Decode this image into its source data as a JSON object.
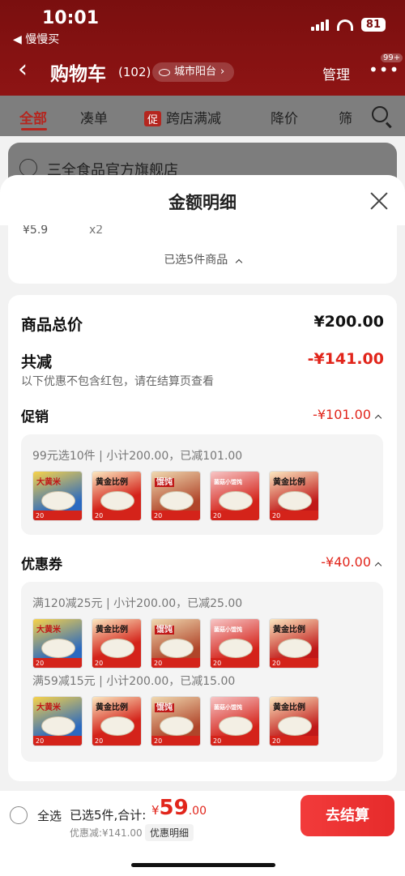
{
  "status_bar": {
    "time": "10:01",
    "back_app": "◀ 慢慢买",
    "battery": "81"
  },
  "header": {
    "back_icon": "chevron-left-icon",
    "title": "购物车",
    "count": "(102)",
    "address": "城市阳台",
    "manage": "管理",
    "more": "•••",
    "badge": "99+"
  },
  "filters": [
    "全部",
    "凑单",
    "跨店满减",
    "降价",
    "筛"
  ],
  "promo_tag": "促",
  "shop_name": "三全食品官方旗舰店",
  "sheet": {
    "title": "金额明细",
    "cut_price": "¥5.9",
    "cut_qty": "x2",
    "selected_note": "已选5件商品"
  },
  "detail": {
    "total_label": "商品总价",
    "total_value": "¥200.00",
    "reduce_label": "共减",
    "reduce_value": "-¥141.00",
    "reduce_note": "以下优惠不包含红包，请在结算页查看",
    "promo_label": "促销",
    "promo_value": "-¥101.00",
    "promo_group": "99元选10件 | 小计200.00，已减101.00",
    "coupon_label": "优惠券",
    "coupon_value": "-¥40.00",
    "coupon_group_1": "满120减25元 | 小计200.00，已减25.00",
    "coupon_group_2": "满59减15元 | 小计200.00，已减15.00"
  },
  "product_thumbs": [
    {
      "label": "大黄米",
      "num": "20"
    },
    {
      "label": "黄金比例",
      "num": "20"
    },
    {
      "label": "馄饨",
      "num": "20"
    },
    {
      "label": "菌菇小馄饨",
      "num": "20"
    },
    {
      "label": "黄金比例",
      "num": "20"
    }
  ],
  "bottom": {
    "select_all": "全选",
    "selected": "已选5件,合计:",
    "currency": "¥",
    "total_int": "59",
    "total_dec": ".00",
    "discount": "优惠减:¥141.00",
    "detail_button": "优惠明细",
    "checkout": "去结算"
  },
  "colors": {
    "accent": "#e1251b",
    "header": "#7a0f0f"
  }
}
